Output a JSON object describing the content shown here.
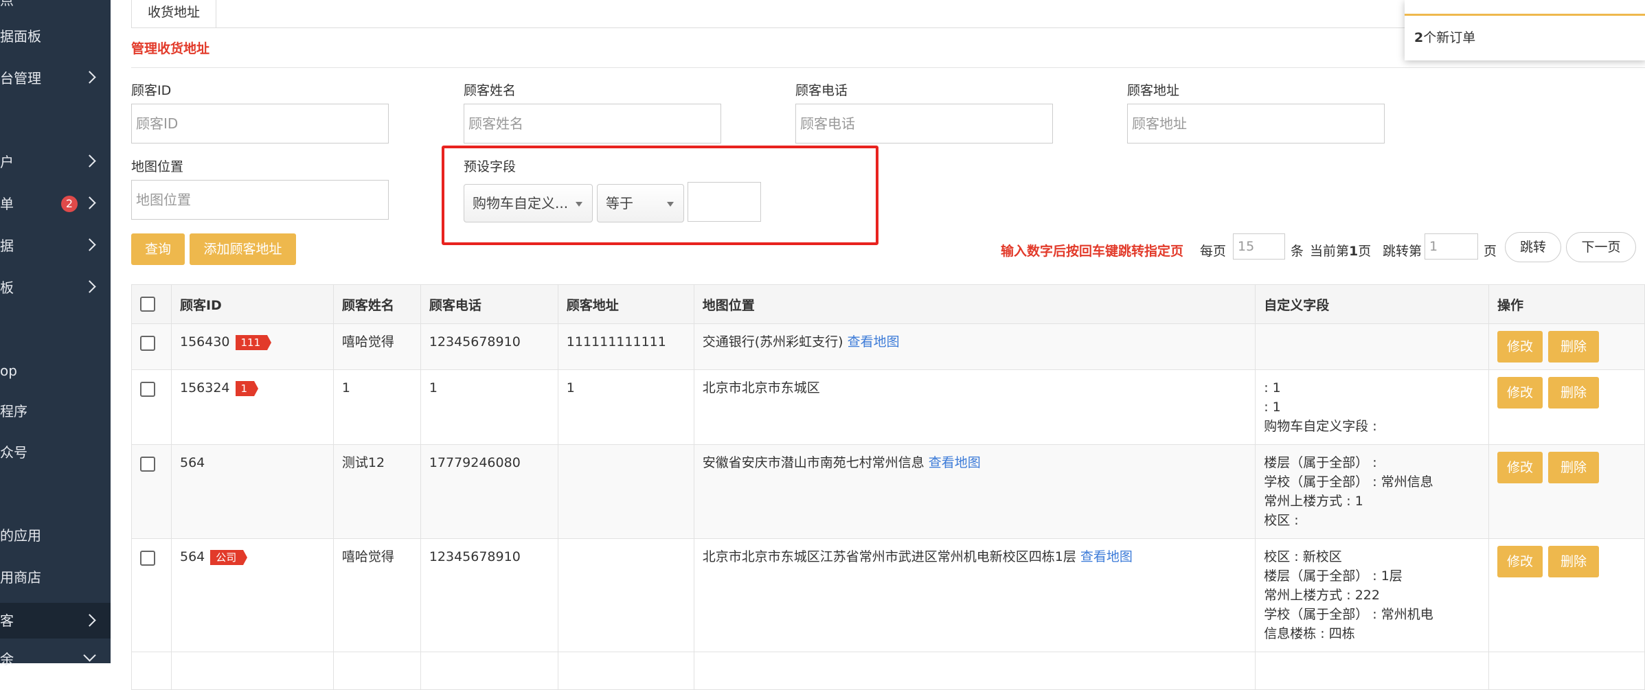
{
  "sidebar": {
    "items": [
      {
        "label": "据面板",
        "chevron": false
      },
      {
        "label": "台管理",
        "chevron": true
      },
      {
        "label": "户",
        "chevron": true
      },
      {
        "label": "单",
        "chevron": true,
        "badge": "2"
      },
      {
        "label": "据",
        "chevron": true
      },
      {
        "label": "板",
        "chevron": true
      },
      {
        "label": "op",
        "chevron": false
      },
      {
        "label": "程序",
        "chevron": false
      },
      {
        "label": "众号",
        "chevron": false
      },
      {
        "label": "的应用",
        "chevron": false
      },
      {
        "label": "用商店",
        "chevron": false
      },
      {
        "label": "客",
        "chevron": true
      },
      {
        "label": "余",
        "chevron": true
      }
    ],
    "top_stub": "点"
  },
  "tab": {
    "label": "收货地址"
  },
  "page_title": "管理收货地址",
  "filters": {
    "customer_id": {
      "label": "顾客ID",
      "placeholder": "顾客ID"
    },
    "customer_name": {
      "label": "顾客姓名",
      "placeholder": "顾客姓名"
    },
    "customer_phone": {
      "label": "顾客电话",
      "placeholder": "顾客电话"
    },
    "customer_address": {
      "label": "顾客地址",
      "placeholder": "顾客地址"
    },
    "map_location": {
      "label": "地图位置",
      "placeholder": "地图位置"
    },
    "preset_field": {
      "label": "预设字段",
      "field_value": "购物车自定义...",
      "operator_value": "等于"
    }
  },
  "buttons": {
    "query": "查询",
    "add": "添加顾客地址"
  },
  "pager": {
    "hint": "输入数字后按回车键跳转指定页",
    "per_page_label": "每页",
    "per_page_value": "15",
    "unit": "条",
    "current_prefix": "当前第",
    "current_page": "1",
    "current_suffix": "页",
    "jump_label": "跳转第",
    "jump_value": "1",
    "jump_suffix": "页",
    "jump_button": "跳转",
    "next_button": "下一页"
  },
  "table": {
    "headers": [
      "顾客ID",
      "顾客姓名",
      "顾客电话",
      "顾客地址",
      "地图位置",
      "自定义字段",
      "操作"
    ],
    "edit_label": "修改",
    "delete_label": "删除",
    "map_link": "查看地图",
    "rows": [
      {
        "id": "156430",
        "tag": "111",
        "name": "嘻哈觉得",
        "phone": "12345678910",
        "address": "111111111111",
        "map": "交通银行(苏州彩虹支行)",
        "has_map_link": true,
        "custom": []
      },
      {
        "id": "156324",
        "tag": "1",
        "name": "1",
        "phone": "1",
        "address": "1",
        "map": "北京市北京市东城区",
        "has_map_link": false,
        "custom": [
          ": 1",
          ": 1",
          "购物车自定义字段 :"
        ]
      },
      {
        "id": "564",
        "tag": "",
        "name": "测试12",
        "phone": "17779246080",
        "address": "",
        "map": "安徽省安庆市潜山市南苑七村常州信息",
        "has_map_link": true,
        "custom": [
          "楼层（属于全部） :",
          "学校（属于全部） : 常州信息",
          "常州上楼方式 : 1",
          "校区 :"
        ]
      },
      {
        "id": "564",
        "tag": "公司",
        "name": "嘻哈觉得",
        "phone": "12345678910",
        "address": "",
        "map": "北京市北京市东城区江苏省常州市武进区常州机电新校区四栋1层",
        "has_map_link": true,
        "custom": [
          "校区 : 新校区",
          "楼层（属于全部） : 1层",
          "常州上楼方式 : 222",
          "学校（属于全部） : 常州机电",
          "信息楼栋 : 四栋"
        ]
      }
    ]
  },
  "notification": {
    "count": "2",
    "text": "个新订单"
  },
  "colors": {
    "sidebar": "#263445",
    "accent": "#eeb84d",
    "danger": "#e23a2a",
    "link": "#3c7bd8",
    "highlight": "#e8231f"
  }
}
